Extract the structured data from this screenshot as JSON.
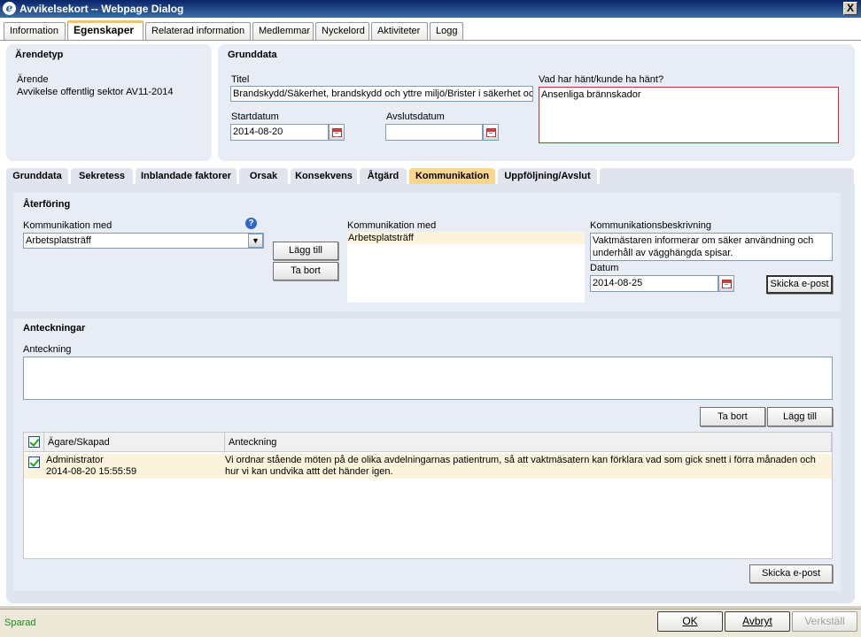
{
  "window": {
    "title": "Avvikelsekort -- Webpage Dialog",
    "close": "X"
  },
  "tabs": [
    {
      "label": "Information"
    },
    {
      "label": "Egenskaper"
    },
    {
      "label": "Relaterad information"
    },
    {
      "label": "Medlemmar"
    },
    {
      "label": "Nyckelord"
    },
    {
      "label": "Aktiviteter"
    },
    {
      "label": "Logg"
    }
  ],
  "arendetyp": {
    "title": "Ärendetyp",
    "label": "Ärende",
    "value": "Avvikelse offentlig sektor AV11-2014"
  },
  "grunddata": {
    "title": "Grunddata",
    "titel_label": "Titel",
    "titel_value": "Brandskydd/Säkerhet, brandskydd och yttre miljö/Brister i säkerhet och",
    "vad_label": "Vad har hänt/kunde ha hänt?",
    "vad_value": "Ansenliga brännskador",
    "start_label": "Startdatum",
    "start_value": "2014-08-20",
    "avslut_label": "Avslutsdatum",
    "avslut_value": ""
  },
  "subtabs": [
    {
      "label": "Grunddata"
    },
    {
      "label": "Sekretess"
    },
    {
      "label": "Inblandade faktorer"
    },
    {
      "label": "Orsak"
    },
    {
      "label": "Konsekvens"
    },
    {
      "label": "Åtgärd"
    },
    {
      "label": "Kommunikation"
    },
    {
      "label": "Uppföljning/Avslut"
    }
  ],
  "aterforing": {
    "title": "Återföring",
    "komm_label": "Kommunikation med",
    "komm_selected": "Arbetsplatsträff",
    "help": "?",
    "add_btn": "Lägg till",
    "remove_btn": "Ta bort",
    "list_label": "Kommunikation med",
    "list_items": [
      "Arbetsplatsträff"
    ],
    "besk_label": "Kommunikationsbeskrivning",
    "besk_value": "Vaktmästaren informerar om säker användning och underhåll av vägghängda spisar.",
    "datum_label": "Datum",
    "datum_value": "2014-08-25",
    "email_btn": "Skicka e-post"
  },
  "anteckningar": {
    "title": "Anteckningar",
    "note_label": "Anteckning",
    "note_value": "",
    "remove_btn": "Ta bort",
    "add_btn": "Lägg till",
    "col_owner": "Ägare/Skapad",
    "col_note": "Anteckning",
    "rows": [
      {
        "owner": "Administrator",
        "created": "2014-08-20 15:55:59",
        "note": "Vi ordnar stående möten på de olika avdelningarnas patientrum, så att vaktmäsatern kan förklara vad som gick snett i förra månaden och hur vi kan undvika attt det händer igen."
      }
    ],
    "email_btn": "Skicka e-post"
  },
  "status": {
    "text": "Sparad"
  },
  "footer": {
    "ok": "OK",
    "cancel": "Avbryt",
    "apply": "Verkställ"
  }
}
